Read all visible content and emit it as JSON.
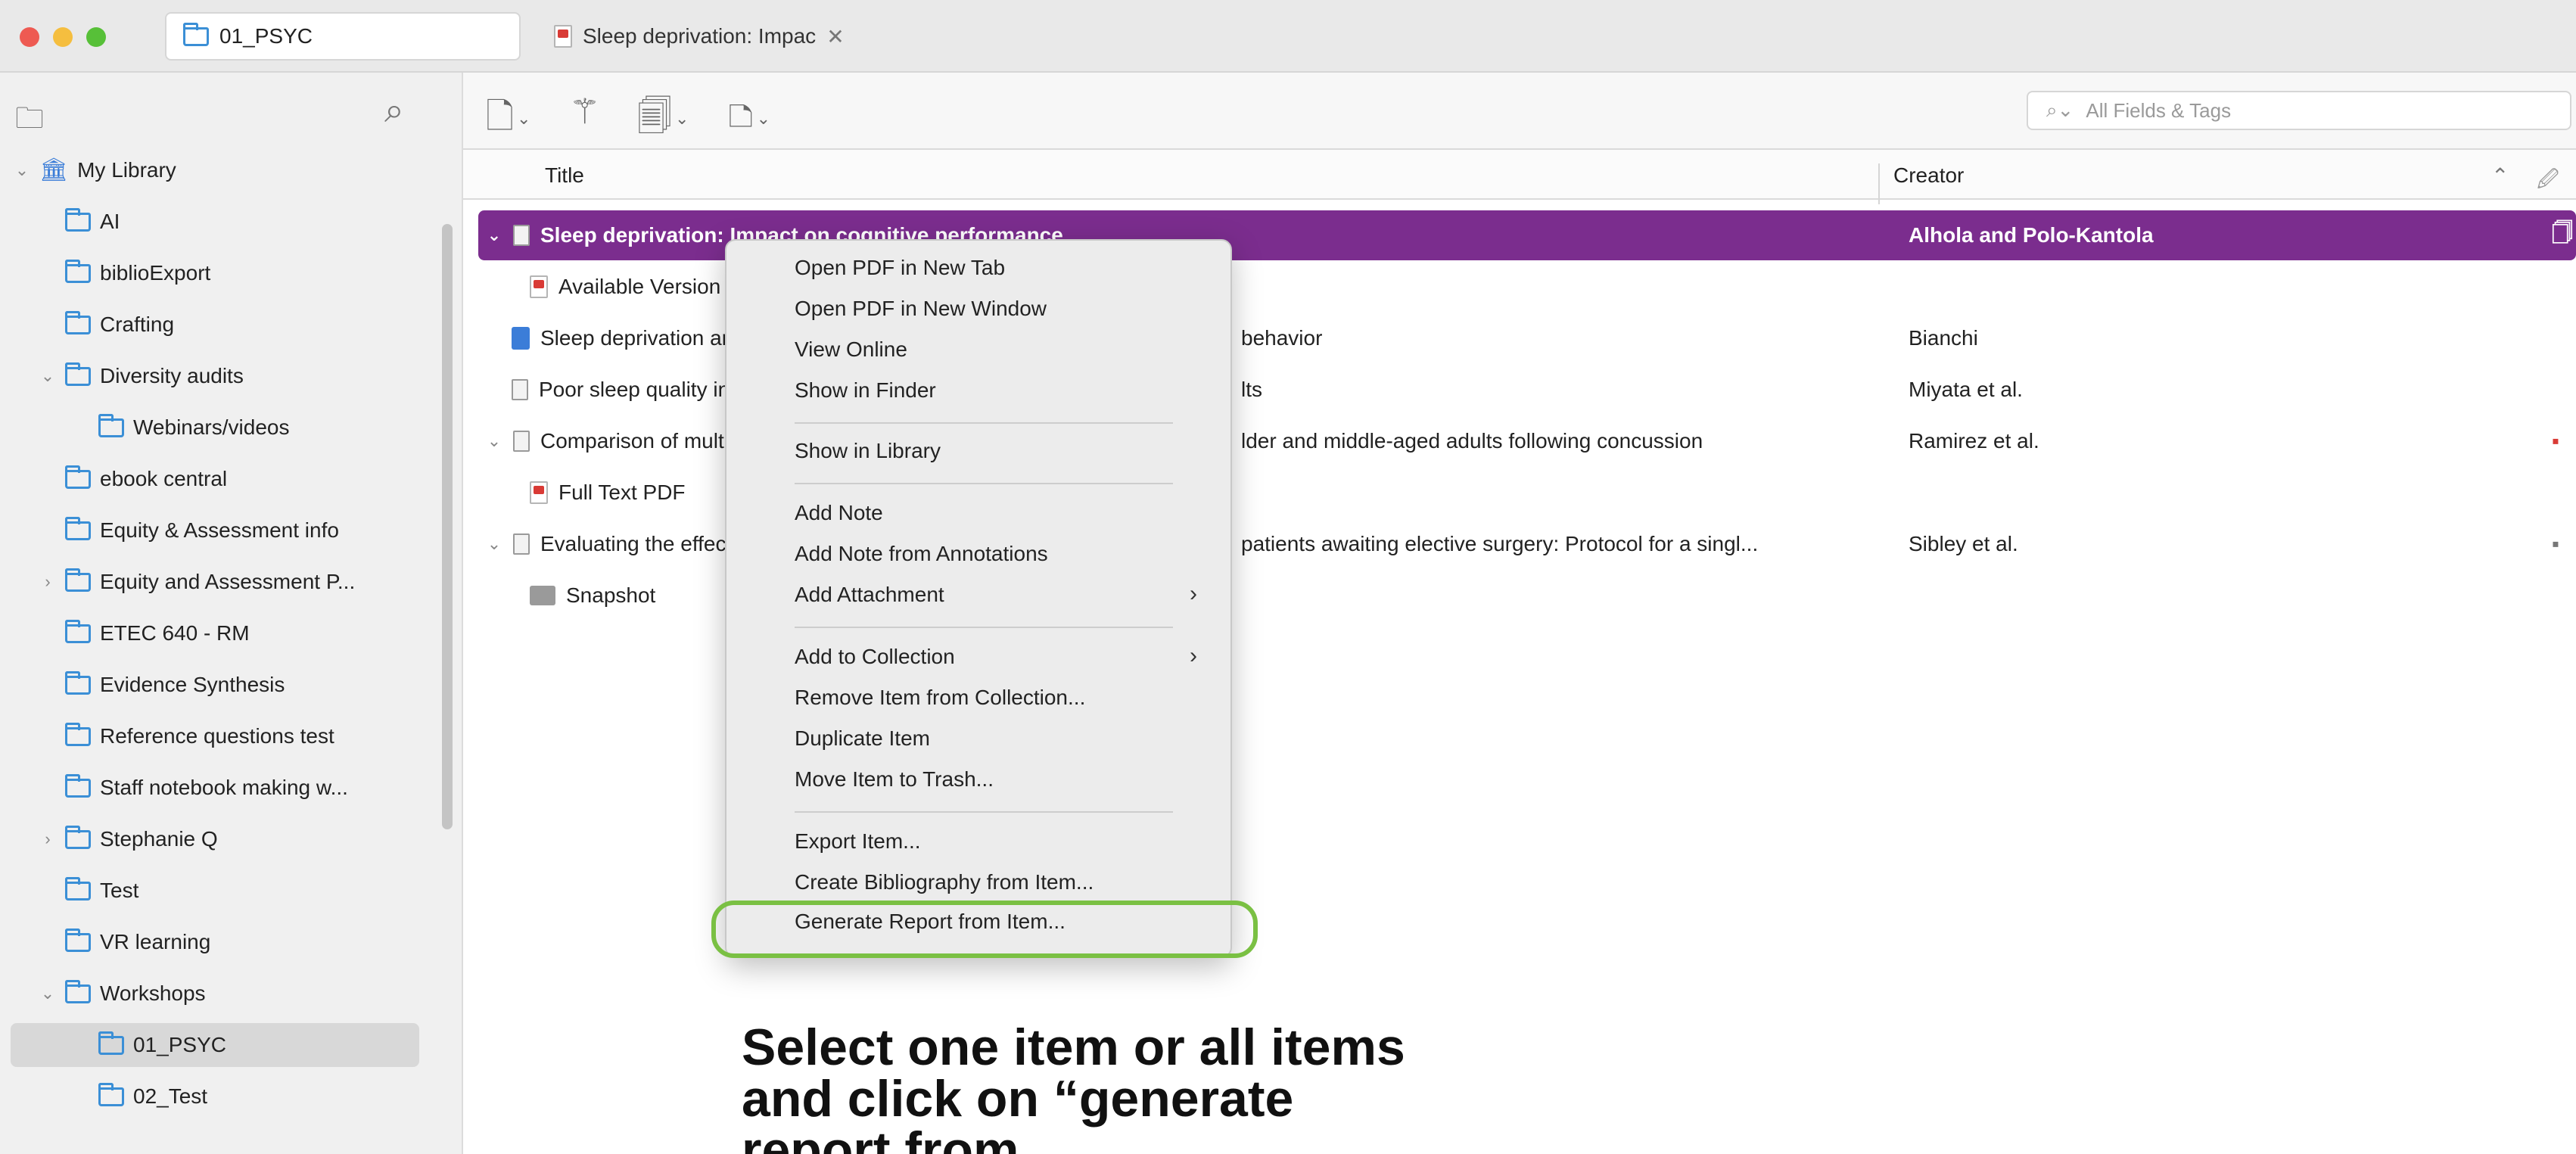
{
  "tabs": {
    "library_tab": "01_PSYC",
    "pdf_tab": "Sleep deprivation: Impac"
  },
  "sidebar": {
    "items": [
      {
        "label": "My Library"
      },
      {
        "label": "AI"
      },
      {
        "label": "biblioExport"
      },
      {
        "label": "Crafting"
      },
      {
        "label": "Diversity audits"
      },
      {
        "label": "Webinars/videos"
      },
      {
        "label": "ebook central"
      },
      {
        "label": "Equity & Assessment info"
      },
      {
        "label": "Equity and Assessment P..."
      },
      {
        "label": "ETEC 640 - RM"
      },
      {
        "label": "Evidence Synthesis"
      },
      {
        "label": "Reference questions test"
      },
      {
        "label": "Staff notebook making w..."
      },
      {
        "label": "Stephanie Q"
      },
      {
        "label": "Test"
      },
      {
        "label": "VR learning"
      },
      {
        "label": "Workshops"
      },
      {
        "label": "01_PSYC"
      },
      {
        "label": "02_Test"
      }
    ]
  },
  "search": {
    "placeholder": "All Fields & Tags"
  },
  "columns": {
    "title": "Title",
    "creator": "Creator"
  },
  "rows": [
    {
      "title": "Sleep deprivation: Impact on cognitive performance",
      "creator": "Alhola and Polo-Kantola"
    },
    {
      "title": "Available Version",
      "creator": ""
    },
    {
      "title": "Sleep deprivation ar",
      "title_tail": "behavior",
      "creator": "Bianchi"
    },
    {
      "title": "Poor sleep quality in",
      "title_tail": "lts",
      "creator": "Miyata et al."
    },
    {
      "title": "Comparison of multi",
      "title_tail": "lder and middle-aged adults following concussion",
      "creator": "Ramirez et al."
    },
    {
      "title": "Full Text PDF",
      "creator": ""
    },
    {
      "title": "Evaluating the effect",
      "title_tail": "patients awaiting elective surgery: Protocol for a singl...",
      "creator": "Sibley et al."
    },
    {
      "title": "Snapshot",
      "creator": ""
    }
  ],
  "context_menu": {
    "items": [
      "Open PDF in New Tab",
      "Open PDF in New Window",
      "View Online",
      "Show in Finder",
      "Show in Library",
      "Add Note",
      "Add Note from Annotations",
      "Add Attachment",
      "Add to Collection",
      "Remove Item from Collection...",
      "Duplicate Item",
      "Move Item to Trash...",
      "Export Item...",
      "Create Bibliography from Item...",
      "Generate Report from Item..."
    ]
  },
  "instruction": "Select one item or all items and click on “generate report from",
  "colors": {
    "selection": "#7b2d8e",
    "highlight_ring": "#7ac043",
    "folder": "#3b8fd6"
  }
}
